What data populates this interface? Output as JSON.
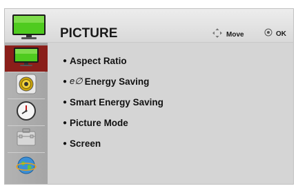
{
  "header": {
    "title": "PICTURE",
    "icon": "monitor-icon",
    "hints": [
      {
        "icon": "four-arrows-icon",
        "label": "Move"
      },
      {
        "icon": "ok-circle-icon",
        "label": "OK"
      }
    ]
  },
  "sidebar": {
    "items": [
      {
        "icon": "monitor-icon",
        "active": true
      },
      {
        "icon": "speaker-icon",
        "active": false
      },
      {
        "icon": "clock-icon",
        "active": false
      },
      {
        "icon": "toolbox-icon",
        "active": false
      },
      {
        "icon": "globe-icon",
        "active": false
      }
    ]
  },
  "menu": {
    "bullet": "●",
    "eco_glyph": "e∅",
    "items": [
      {
        "label": "Aspect Ratio"
      },
      {
        "label": "Energy Saving"
      },
      {
        "label": "Smart Energy Saving"
      },
      {
        "label": "Picture Mode"
      },
      {
        "label": "Screen"
      }
    ]
  },
  "colors": {
    "active_tab": "#8a1f1a",
    "panel": "#d5d5d5",
    "sidebar": "#aaaaaa",
    "screen_green": "#4fcb1f"
  }
}
